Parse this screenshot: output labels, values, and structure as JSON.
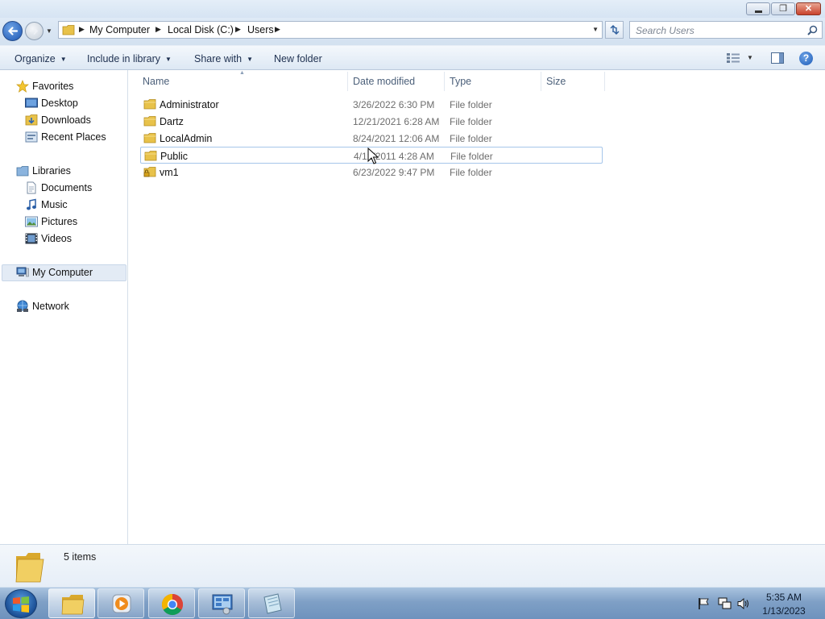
{
  "window": {
    "minimize_glyph": "",
    "maximize_glyph": "❐",
    "close_glyph": "✕"
  },
  "address": {
    "breadcrumbs": [
      "My Computer",
      "Local Disk (C:)",
      "Users"
    ],
    "search_placeholder": "Search Users"
  },
  "toolbar": {
    "organize": "Organize",
    "include_in_library": "Include in library",
    "share_with": "Share with",
    "new_folder": "New folder",
    "help": "?"
  },
  "nav": {
    "favorites": "Favorites",
    "desktop": "Desktop",
    "downloads": "Downloads",
    "recent_places": "Recent Places",
    "libraries": "Libraries",
    "documents": "Documents",
    "music": "Music",
    "pictures": "Pictures",
    "videos": "Videos",
    "my_computer": "My Computer",
    "network": "Network"
  },
  "columns": {
    "name": "Name",
    "date_modified": "Date modified",
    "type": "Type",
    "size": "Size"
  },
  "files": [
    {
      "name": "Administrator",
      "date": "3/26/2022 6:30 PM",
      "type": "File folder",
      "locked": false
    },
    {
      "name": "Dartz",
      "date": "12/21/2021 6:28 AM",
      "type": "File folder",
      "locked": false
    },
    {
      "name": "LocalAdmin",
      "date": "8/24/2021 12:06 AM",
      "type": "File folder",
      "locked": false
    },
    {
      "name": "Public",
      "date": "4/12/2011 4:28 AM",
      "type": "File folder",
      "locked": false
    },
    {
      "name": "vm1",
      "date": "6/23/2022 9:47 PM",
      "type": "File folder",
      "locked": true
    }
  ],
  "details": {
    "item_count": "5 items"
  },
  "clock": {
    "time": "5:35 AM",
    "date": "1/13/2023"
  },
  "colors": {
    "accent": "#1b55b3",
    "selection_border": "#a6c6ea",
    "folder": "#e8c24a"
  }
}
